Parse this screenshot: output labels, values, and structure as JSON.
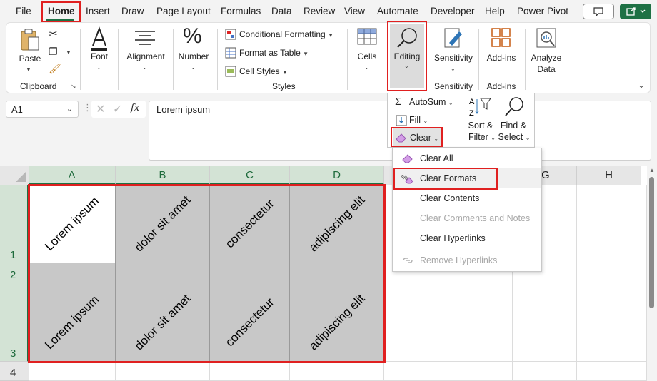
{
  "menu": {
    "tabs": [
      "File",
      "Home",
      "Insert",
      "Draw",
      "Page Layout",
      "Formulas",
      "Data",
      "Review",
      "View",
      "Automate",
      "Developer",
      "Help",
      "Power Pivot"
    ]
  },
  "ribbon": {
    "clipboard": {
      "paste": "Paste",
      "group": "Clipboard"
    },
    "font": {
      "label": "Font"
    },
    "alignment": {
      "label": "Alignment"
    },
    "number": {
      "label": "Number"
    },
    "styles": {
      "conditional": "Conditional Formatting",
      "format_table": "Format as Table",
      "cell_styles": "Cell Styles",
      "group": "Styles"
    },
    "cells": {
      "label": "Cells"
    },
    "editing": {
      "label": "Editing"
    },
    "sensitivity": {
      "label": "Sensitivity",
      "group": "Sensitivity"
    },
    "addins": {
      "label": "Add-ins",
      "group": "Add-ins"
    },
    "analyze": {
      "line1": "Analyze",
      "line2": "Data"
    }
  },
  "formula_bar": {
    "name_box": "A1",
    "content": "Lorem ipsum",
    "fx": "fx"
  },
  "columns": [
    "A",
    "B",
    "C",
    "D",
    "G",
    "H"
  ],
  "rows": [
    "1",
    "2",
    "3",
    "4"
  ],
  "cells": {
    "r1": [
      "Lorem ipsum",
      "dolor sit amet",
      "consectetur",
      "adipiscing elit"
    ],
    "r3": [
      "Lorem ipsum",
      "dolor sit amet",
      "consectetur",
      "adipiscing elit"
    ]
  },
  "editing_menu": {
    "autosum": "AutoSum",
    "fill": "Fill",
    "clear": "Clear",
    "sort_line1": "Sort &",
    "sort_line2": "Filter",
    "find_line1": "Find &",
    "find_line2": "Select"
  },
  "clear_menu": {
    "items": [
      "Clear All",
      "Clear Formats",
      "Clear Contents",
      "Clear Comments and Notes",
      "Clear Hyperlinks",
      "Remove Hyperlinks"
    ]
  },
  "colors": {
    "accent": "#1e7145",
    "highlight": "#e02020",
    "selection_fill": "#c8c8c8"
  }
}
